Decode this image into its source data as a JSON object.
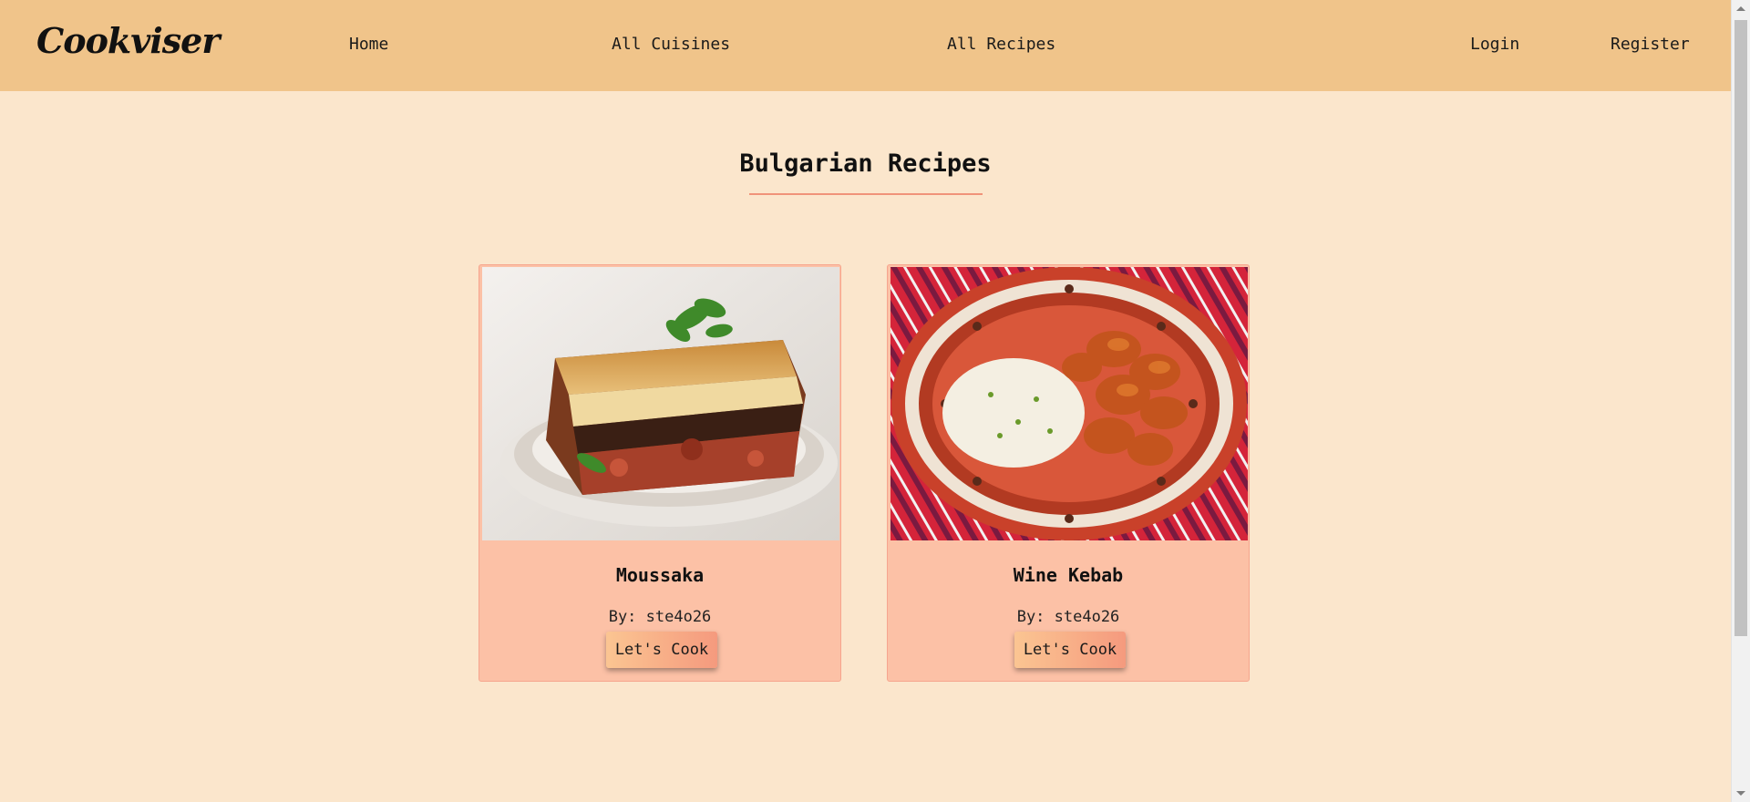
{
  "nav": {
    "logo": "Cookviser",
    "home": "Home",
    "cuisines": "All Cuisines",
    "recipes": "All Recipes",
    "login": "Login",
    "register": "Register"
  },
  "main": {
    "title": "Bulgarian Recipes",
    "recipes": [
      {
        "name": "Moussaka",
        "author": "By: ste4o26",
        "button": "Let's Cook",
        "image_icon": "moussaka-photo"
      },
      {
        "name": "Wine Kebab",
        "author": "By: ste4o26",
        "button": "Let's Cook",
        "image_icon": "wine-kebab-photo"
      }
    ]
  },
  "colors": {
    "navbar": "#f0c48a",
    "background": "#fbe6cc",
    "card": "#fcc1a6",
    "accent": "#f0937a"
  }
}
